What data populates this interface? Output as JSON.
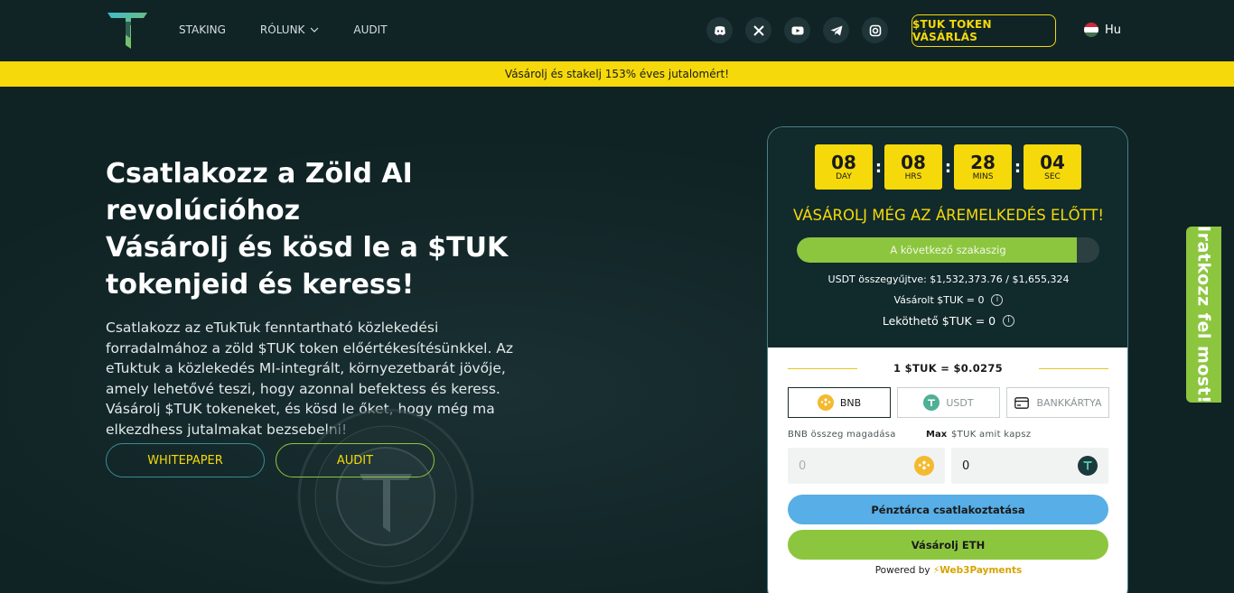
{
  "nav": {
    "items": [
      "STAKING",
      "RÓLUNK",
      "AUDIT"
    ]
  },
  "social": [
    "discord-icon",
    "x-icon",
    "youtube-icon",
    "telegram-icon",
    "instagram-icon"
  ],
  "header": {
    "buy_label": "$TUK TOKEN VÁSÁRLÁS",
    "lang": "Hu"
  },
  "banner": {
    "text": "Vásárolj és stakelj 153% éves jutalomért!"
  },
  "hero": {
    "title_lines": [
      "Csatlakozz a  Zöld AI",
      "revolúcióhoz",
      "Vásárolj és kösd le a $TUK",
      "tokenjeid és keress!"
    ],
    "description": "Csatlakozz az eTukTuk fenntartható közlekedési forradalmához a zöld $TUK token előértékesítésünkkel. Az eTuktuk a közlekedés MI-integrált, környezetbarát jövője, amely lehetővé teszi, hogy azonnal befektess és keress. Vásárolj $TUK tokeneket, és kösd le őket, hogy még ma elkezdhess jutalmakat bezsebelni!",
    "whitepaper_label": "WHITEPAPER",
    "audit_label": "AUDIT"
  },
  "card": {
    "timer": [
      {
        "value": "08",
        "label": "DAY"
      },
      {
        "value": "08",
        "label": "HRS"
      },
      {
        "value": "28",
        "label": "MINS"
      },
      {
        "value": "04",
        "label": "SEC"
      }
    ],
    "timer_separator": ":",
    "headline": "VÁSÁROLJ MÉG AZ ÁREMELKEDÉS ELŐTT!",
    "progress_label": "A következő szakaszig",
    "progress_fraction": 0.925,
    "raised": "USDT összegyűjtve: $1,532,373.76 / $1,655,324",
    "purchased": "Vásárolt $TUK = 0",
    "stakeable": "Leköthető $TUK = 0",
    "info_glyph": "i",
    "rate": "1 $TUK = $0.0275",
    "tabs": [
      "BNB",
      "USDT",
      "BANKKÁRTYA"
    ],
    "amount_label": "BNB összeg magadása",
    "max_label": "Max",
    "receive_label": "$TUK amit kapsz",
    "amount_placeholder": "0",
    "receive_value": "0",
    "connect_label": "Pénztárca csatlakoztatása",
    "buy_label": "Vásárolj ETH",
    "powered_prefix": "Powered by",
    "powered_brand": "Web3Payments"
  },
  "side_tab": {
    "label": "Iratkozz fel most!"
  },
  "colors": {
    "accent_yellow": "#f5d90a",
    "accent_green": "#8cc63f",
    "accent_blue": "#58aee6",
    "bg_dark": "#0f2224"
  }
}
